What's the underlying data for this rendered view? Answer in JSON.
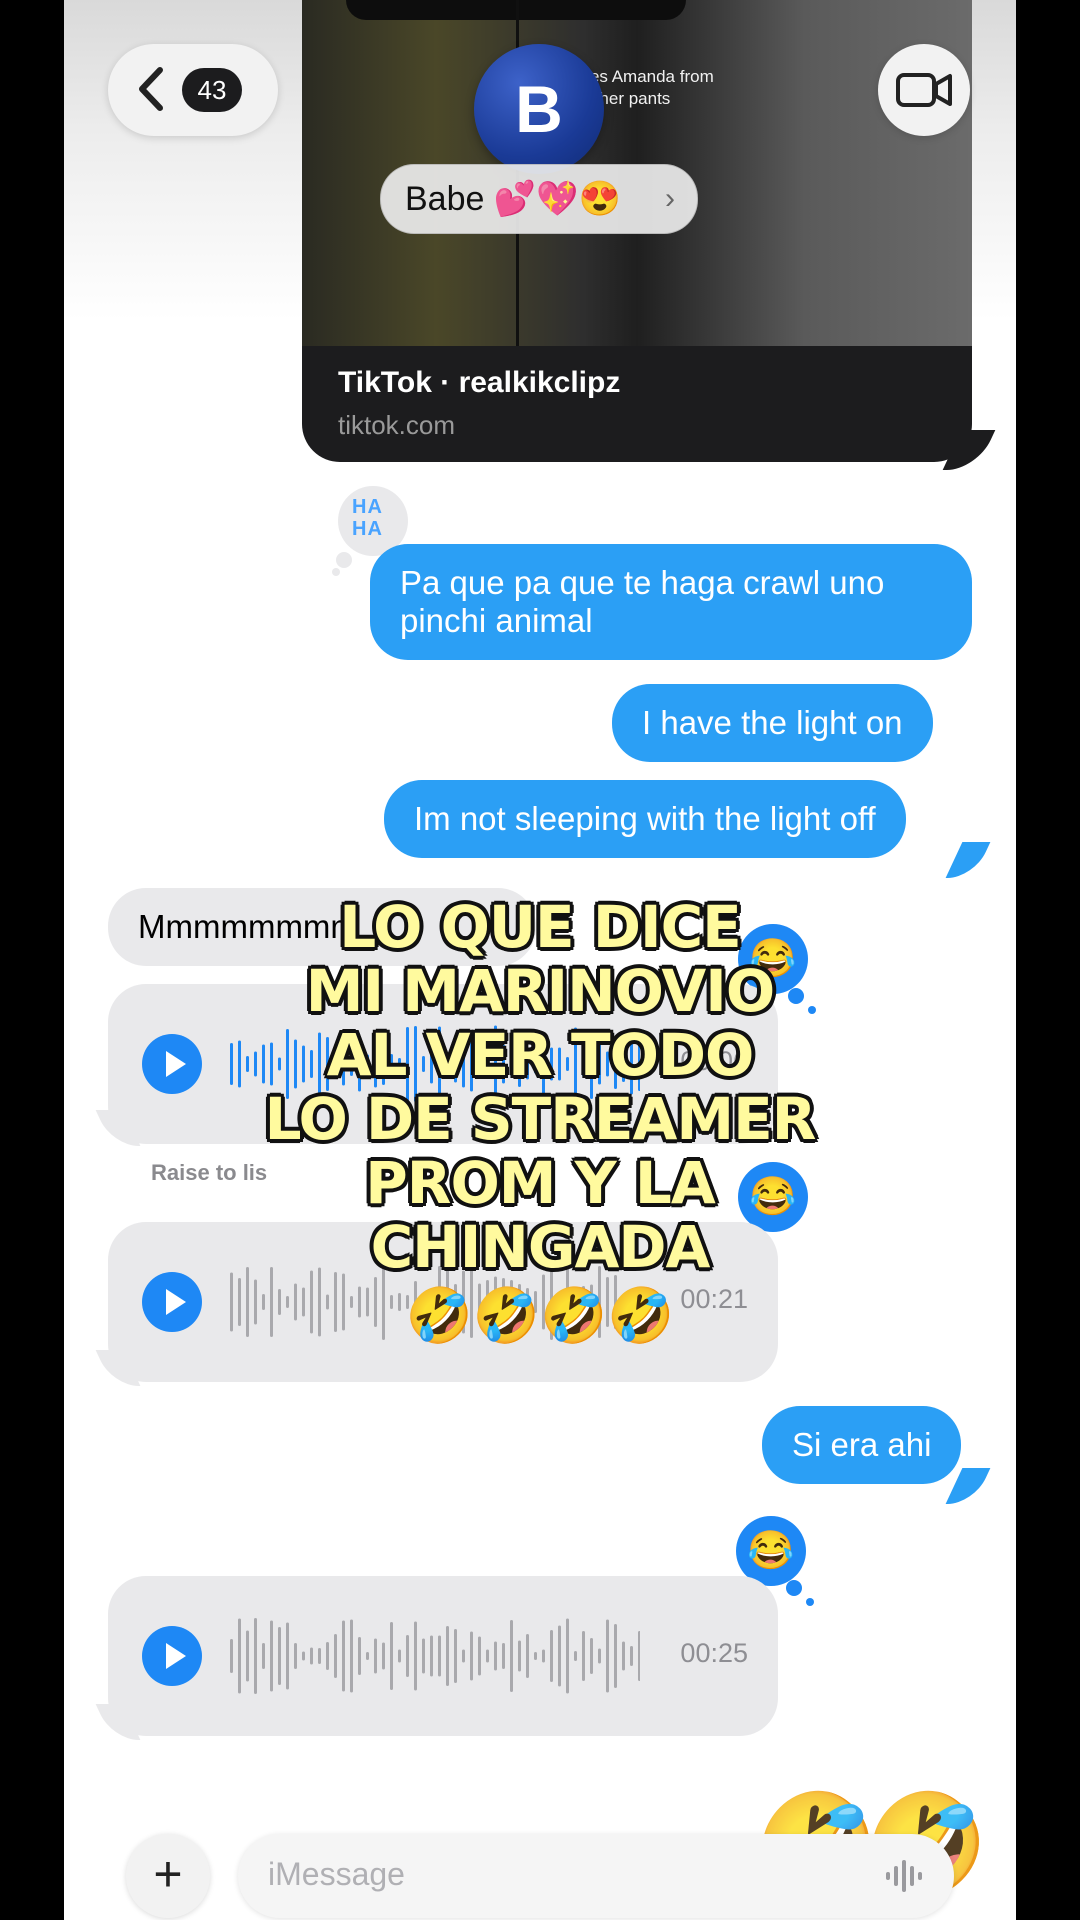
{
  "header": {
    "back_count": "43",
    "contact_initial": "B",
    "contact_name": "Babe 💕💖😍",
    "chevron": "›"
  },
  "link_preview": {
    "thumbnail_caption": "aves Amanda from\ning her pants",
    "title": "TikTok · realkikclipz",
    "domain": "tiktok.com"
  },
  "reactions": {
    "haha_text": "HA\nHA",
    "laugh_emoji": "😂"
  },
  "messages": [
    {
      "from": "me",
      "text": "Pa que pa que te haga crawl uno pinchi animal"
    },
    {
      "from": "me",
      "text": "I have the light on"
    },
    {
      "from": "me",
      "text": "Im not sleeping with the light off"
    },
    {
      "from": "them",
      "text": "Mmmmmmmm"
    },
    {
      "from": "them",
      "type": "audio",
      "duration": "00:06"
    },
    {
      "from": "them",
      "type": "audio",
      "duration": "00:21"
    },
    {
      "from": "me",
      "text": "Si era ahi"
    },
    {
      "from": "them",
      "type": "audio",
      "duration": "00:25"
    }
  ],
  "raise_to_listen": "Raise to lis",
  "overlay_caption": {
    "lines": [
      "LO QUE DICE",
      "MI MARINOVIO",
      "AL VER TODO",
      "LO DE STREAMER",
      "PROM Y LA CHINGADA"
    ],
    "emojis": "🤣🤣🤣🤣"
  },
  "bottom": {
    "floating_emojis": "🤣",
    "plus": "+",
    "input_placeholder": "iMessage"
  },
  "colors": {
    "imessage_blue": "#2b9ff5",
    "incoming_grey": "#e9e9eb",
    "play_blue": "#1e88f5",
    "caption_yellow": "#fffa9e"
  },
  "icons": [
    "chevron-left-icon",
    "video-camera-icon",
    "play-icon",
    "waveform-icon",
    "plus-icon",
    "microphone-waveform-icon",
    "haha-reaction-icon",
    "laugh-emoji-icon"
  ]
}
